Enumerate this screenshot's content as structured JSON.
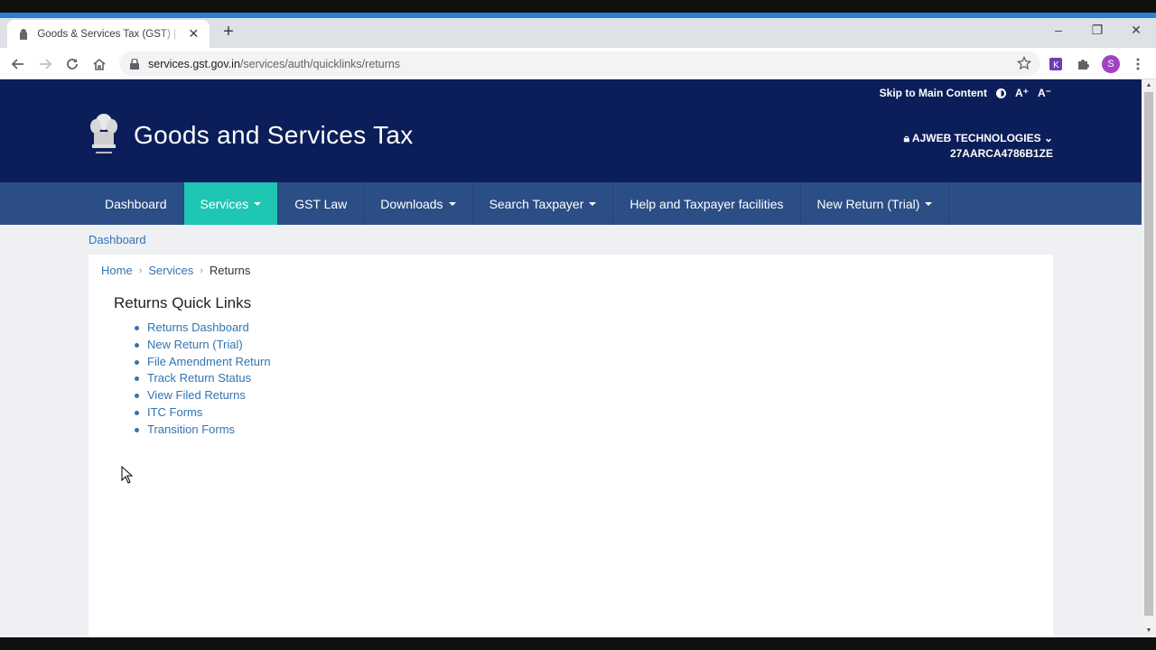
{
  "browser": {
    "tab_title": "Goods & Services Tax (GST) | Services",
    "url_host": "services.gst.gov.in",
    "url_path": "/services/auth/quicklinks/returns",
    "profile_initial": "S",
    "brand_colors": {
      "tab_strip": "#dee1e6",
      "accent_strip": "#2a7fd4"
    }
  },
  "header": {
    "skip_link": "Skip to Main Content",
    "font_increase": "A⁺",
    "font_decrease": "A⁻",
    "site_title": "Goods and Services Tax",
    "user_name": "AJWEB TECHNOLOGIES",
    "gstin": "27AARCA4786B1ZE",
    "colors": {
      "header_bg": "#0b1e59",
      "menu_bg": "#2c4e86",
      "active_menu": "#1fc6b3"
    }
  },
  "menu": [
    {
      "label": "Dashboard",
      "dropdown": false,
      "active": false
    },
    {
      "label": "Services",
      "dropdown": true,
      "active": true
    },
    {
      "label": "GST Law",
      "dropdown": false,
      "active": false
    },
    {
      "label": "Downloads",
      "dropdown": true,
      "active": false
    },
    {
      "label": "Search Taxpayer",
      "dropdown": true,
      "active": false
    },
    {
      "label": "Help and Taxpayer facilities",
      "dropdown": false,
      "active": false
    },
    {
      "label": "New Return (Trial)",
      "dropdown": true,
      "active": false
    }
  ],
  "page": {
    "dashboard_link": "Dashboard",
    "breadcrumb": {
      "home": "Home",
      "services": "Services",
      "current": "Returns"
    },
    "section_title": "Returns Quick Links",
    "links": [
      "Returns Dashboard",
      "New Return (Trial)",
      "File Amendment Return",
      "Track Return Status",
      "View Filed Returns",
      "ITC Forms",
      "Transition Forms"
    ]
  }
}
